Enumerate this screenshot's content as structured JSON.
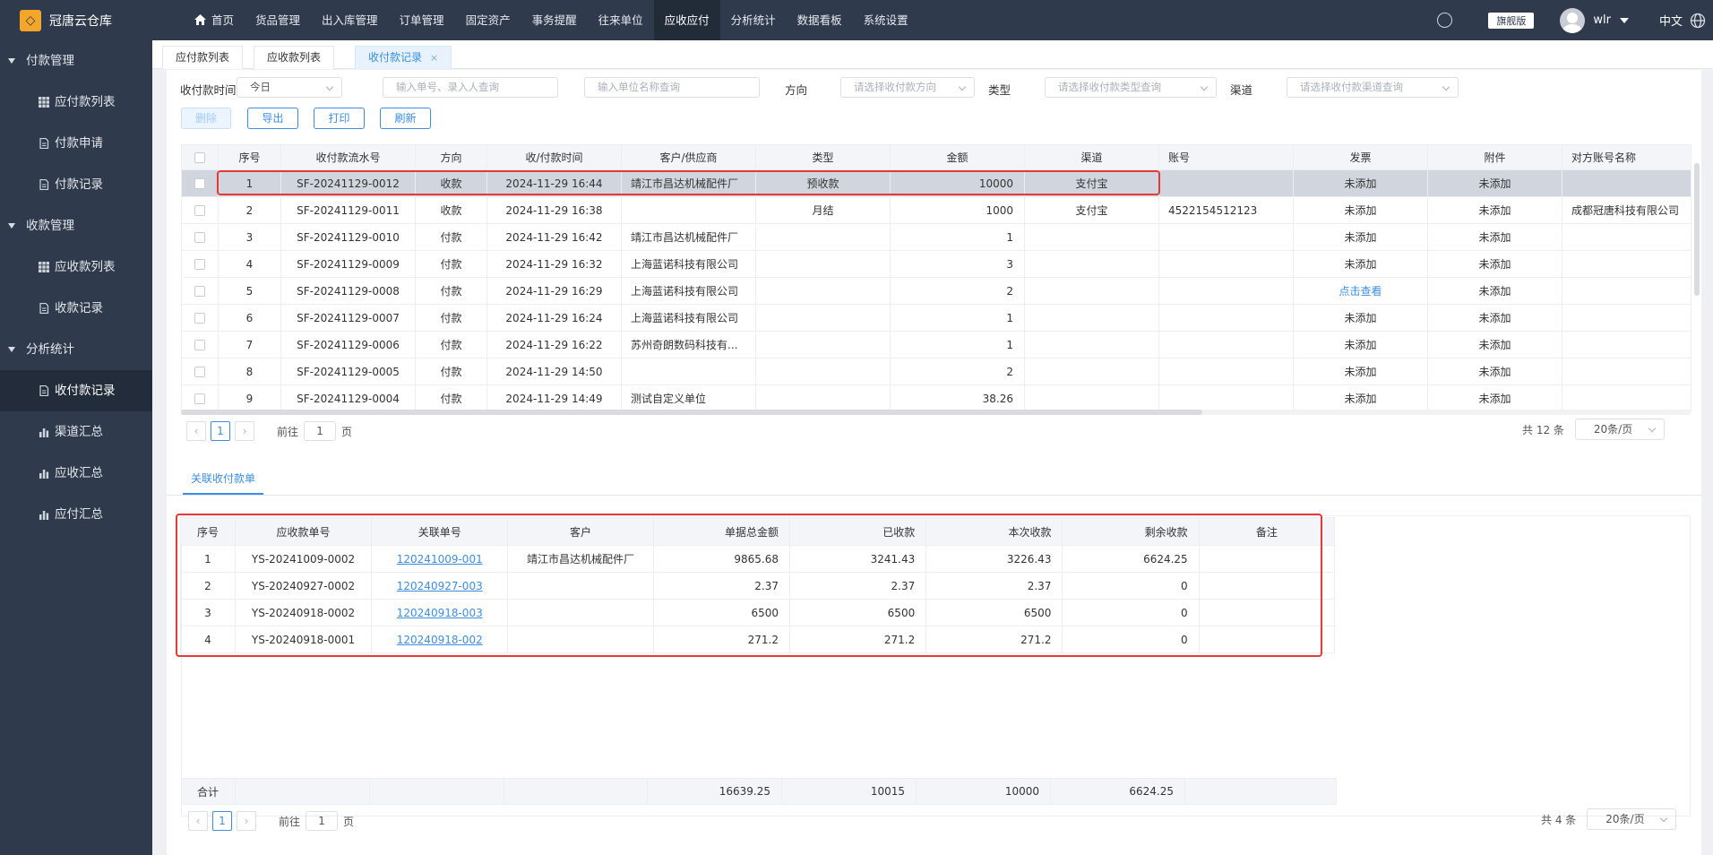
{
  "app": {
    "name": "冠唐云仓库"
  },
  "nav": {
    "items": [
      "首页",
      "货品管理",
      "出入库管理",
      "订单管理",
      "固定资产",
      "事务提醒",
      "往来单位",
      "应收应付",
      "分析统计",
      "数据看板",
      "系统设置"
    ],
    "active_index": 7
  },
  "header": {
    "edition": "旗舰版",
    "user": "wlr",
    "language": "中文"
  },
  "sidebar": {
    "groups": [
      {
        "label": "付款管理",
        "items": [
          "应付款列表",
          "付款申请",
          "付款记录"
        ]
      },
      {
        "label": "收款管理",
        "items": [
          "应收款列表",
          "收款记录"
        ]
      },
      {
        "label": "分析统计",
        "items": [
          "收付款记录",
          "渠道汇总",
          "应收汇总",
          "应付汇总"
        ]
      }
    ],
    "active_item": "收付款记录"
  },
  "tabs": {
    "items": [
      "应付款列表",
      "应收款列表",
      "收付款记录"
    ],
    "active_index": 2,
    "close_glyph": "×"
  },
  "filters": {
    "time_label": "收付款时间",
    "time_value": "今日",
    "order_placeholder": "输入单号、录入人查询",
    "unit_placeholder": "输入单位名称查询",
    "direction_label": "方向",
    "direction_placeholder": "请选择收付款方向",
    "type_label": "类型",
    "type_placeholder": "请选择收付款类型查询",
    "channel_label": "渠道",
    "channel_placeholder": "请选择收付款渠道查询"
  },
  "actions": {
    "delete": "删除",
    "export": "导出",
    "print": "打印",
    "refresh": "刷新"
  },
  "records": {
    "columns": [
      "序号",
      "收付款流水号",
      "方向",
      "收/付款时间",
      "客户/供应商",
      "类型",
      "金额",
      "渠道",
      "账号",
      "发票",
      "附件",
      "对方账号名称"
    ],
    "rows": [
      {
        "no": "1",
        "serial": "SF-20241129-0012",
        "direction": "收款",
        "time": "2024-11-29 16:44",
        "party": "靖江市昌达机械配件厂",
        "type": "预收款",
        "amount": "10000",
        "channel": "支付宝",
        "account": "",
        "invoice": "未添加",
        "attachment": "未添加",
        "counterparty": ""
      },
      {
        "no": "2",
        "serial": "SF-20241129-0011",
        "direction": "收款",
        "time": "2024-11-29 16:38",
        "party": "",
        "type": "月结",
        "amount": "1000",
        "channel": "支付宝",
        "account": "4522154512123",
        "invoice": "未添加",
        "attachment": "未添加",
        "counterparty": "成都冠唐科技有限公司"
      },
      {
        "no": "3",
        "serial": "SF-20241129-0010",
        "direction": "付款",
        "time": "2024-11-29 16:42",
        "party": "靖江市昌达机械配件厂",
        "type": "",
        "amount": "1",
        "channel": "",
        "account": "",
        "invoice": "未添加",
        "attachment": "未添加",
        "counterparty": ""
      },
      {
        "no": "4",
        "serial": "SF-20241129-0009",
        "direction": "付款",
        "time": "2024-11-29 16:32",
        "party": "上海蓝诺科技有限公司",
        "type": "",
        "amount": "3",
        "channel": "",
        "account": "",
        "invoice": "未添加",
        "attachment": "未添加",
        "counterparty": ""
      },
      {
        "no": "5",
        "serial": "SF-20241129-0008",
        "direction": "付款",
        "time": "2024-11-29 16:29",
        "party": "上海蓝诺科技有限公司",
        "type": "",
        "amount": "2",
        "channel": "",
        "account": "",
        "invoice": "点击查看",
        "attachment": "未添加",
        "counterparty": ""
      },
      {
        "no": "6",
        "serial": "SF-20241129-0007",
        "direction": "付款",
        "time": "2024-11-29 16:24",
        "party": "上海蓝诺科技有限公司",
        "type": "",
        "amount": "1",
        "channel": "",
        "account": "",
        "invoice": "未添加",
        "attachment": "未添加",
        "counterparty": ""
      },
      {
        "no": "7",
        "serial": "SF-20241129-0006",
        "direction": "付款",
        "time": "2024-11-29 16:22",
        "party": "苏州奇朗数码科技有...",
        "type": "",
        "amount": "1",
        "channel": "",
        "account": "",
        "invoice": "未添加",
        "attachment": "未添加",
        "counterparty": ""
      },
      {
        "no": "8",
        "serial": "SF-20241129-0005",
        "direction": "付款",
        "time": "2024-11-29 14:50",
        "party": "",
        "type": "",
        "amount": "2",
        "channel": "",
        "account": "",
        "invoice": "未添加",
        "attachment": "未添加",
        "counterparty": ""
      },
      {
        "no": "9",
        "serial": "SF-20241129-0004",
        "direction": "付款",
        "time": "2024-11-29 14:49",
        "party": "测试自定义单位",
        "type": "",
        "amount": "38.26",
        "channel": "",
        "account": "",
        "invoice": "未添加",
        "attachment": "未添加",
        "counterparty": ""
      }
    ]
  },
  "pager1": {
    "page": "1",
    "goto_prefix": "前往",
    "goto_value": "1",
    "goto_suffix": "页",
    "total": "共 12 条",
    "size": "20条/页"
  },
  "related": {
    "tab_label": "关联收付款单",
    "columns": [
      "序号",
      "应收款单号",
      "关联单号",
      "客户",
      "单据总金额",
      "已收款",
      "本次收款",
      "剩余收款",
      "备注"
    ],
    "rows": [
      {
        "no": "1",
        "order": "YS-20241009-0002",
        "ref": "120241009-001",
        "customer": "靖江市昌达机械配件厂",
        "total": "9865.68",
        "received": "3241.43",
        "current": "3226.43",
        "remaining": "6624.25",
        "note": ""
      },
      {
        "no": "2",
        "order": "YS-20240927-0002",
        "ref": "120240927-003",
        "customer": "",
        "total": "2.37",
        "received": "2.37",
        "current": "2.37",
        "remaining": "0",
        "note": ""
      },
      {
        "no": "3",
        "order": "YS-20240918-0002",
        "ref": "120240918-003",
        "customer": "",
        "total": "6500",
        "received": "6500",
        "current": "6500",
        "remaining": "0",
        "note": ""
      },
      {
        "no": "4",
        "order": "YS-20240918-0001",
        "ref": "120240918-002",
        "customer": "",
        "total": "271.2",
        "received": "271.2",
        "current": "271.2",
        "remaining": "0",
        "note": ""
      }
    ],
    "summary": {
      "label": "合计",
      "total": "16639.25",
      "received": "10015",
      "current": "10000",
      "remaining": "6624.25"
    }
  },
  "pager2": {
    "page": "1",
    "goto_prefix": "前往",
    "goto_value": "1",
    "goto_suffix": "页",
    "total": "共 4 条",
    "size": "20条/页"
  },
  "colors": {
    "accent": "#3a8ee6",
    "sidebar_bg": "#2f3a4c",
    "highlight_red": "#e53935",
    "logo": "#f4a62a"
  }
}
